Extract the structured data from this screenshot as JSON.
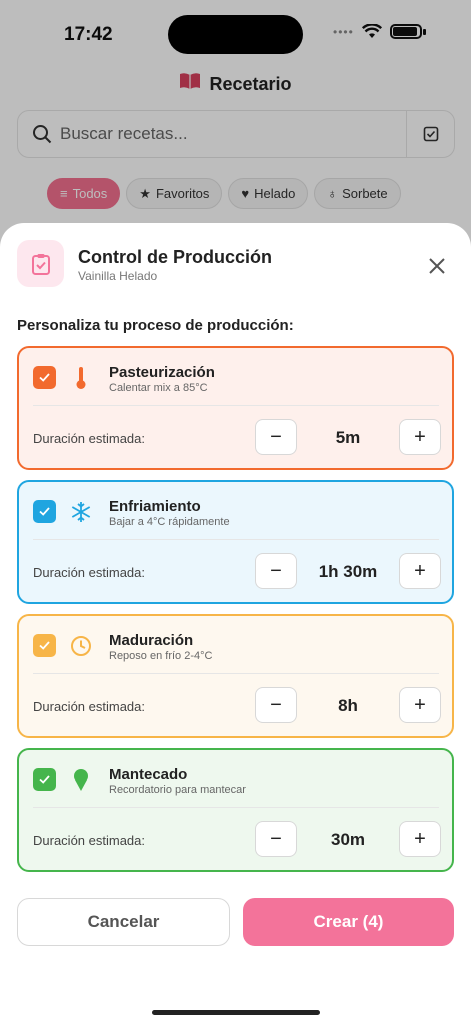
{
  "status_bar": {
    "time": "17:42",
    "dots": "••••"
  },
  "app": {
    "title": "Recetario",
    "search_placeholder": "Buscar recetas...",
    "chips": [
      {
        "label": "Todos",
        "icon": "list-icon",
        "active": true
      },
      {
        "label": "Favoritos",
        "icon": "star-icon"
      },
      {
        "label": "Helado",
        "icon": "ice-cream-icon"
      },
      {
        "label": "Sorbete",
        "icon": "sorbet-icon"
      }
    ]
  },
  "sheet": {
    "title": "Control de Producción",
    "subtitle": "Vainilla Helado",
    "section_label": "Personaliza tu proceso de producción:",
    "duration_label": "Duración estimada:",
    "steps": [
      {
        "name": "Pasteurización",
        "description": "Calentar mix a 85°C",
        "duration": "5m",
        "checked": true,
        "icon": "thermometer-icon",
        "color": "#f26a2e",
        "bg": "#fef0ec"
      },
      {
        "name": "Enfriamiento",
        "description": "Bajar a 4°C rápidamente",
        "duration": "1h 30m",
        "checked": true,
        "icon": "snowflake-icon",
        "color": "#1fa5e0",
        "bg": "#ebf7fd"
      },
      {
        "name": "Maduración",
        "description": "Reposo en frío 2-4°C",
        "duration": "8h",
        "checked": true,
        "icon": "clock-icon",
        "color": "#f7b548",
        "bg": "#fef8ef"
      },
      {
        "name": "Mantecado",
        "description": "Recordatorio para mantecar",
        "duration": "30m",
        "checked": true,
        "icon": "ice-cream-icon",
        "color": "#45b54c",
        "bg": "#eef8ee"
      }
    ],
    "cancel_label": "Cancelar",
    "create_label": "Crear (4)"
  },
  "colors": {
    "accent": "#f3739a",
    "accent_light": "#fde7ee"
  }
}
